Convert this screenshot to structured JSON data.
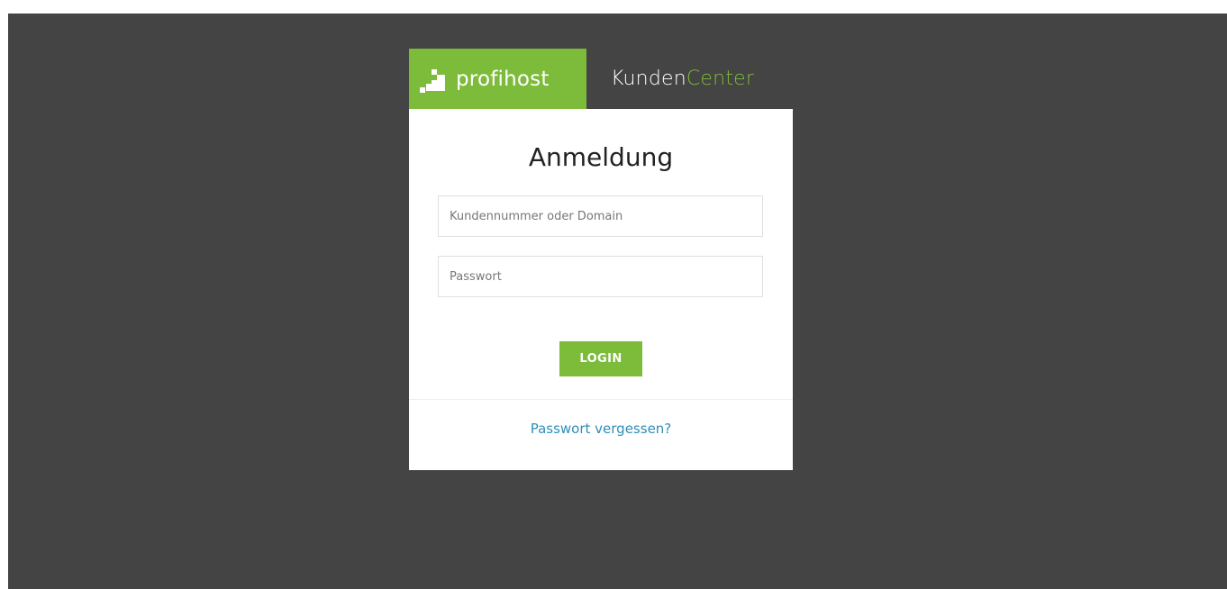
{
  "brand": {
    "name": "profihost",
    "logo_icon": "profihost-logo-icon",
    "color": "#7dbb3a"
  },
  "app_title": {
    "part1": "Kunden",
    "part2": "Center"
  },
  "login": {
    "title": "Anmeldung",
    "username_placeholder": "Kundennummer oder Domain",
    "username_value": "",
    "password_placeholder": "Passwort",
    "password_value": "",
    "submit_label": "LOGIN",
    "forgot_label": "Passwort vergessen?"
  },
  "colors": {
    "background": "#444444",
    "accent": "#7dbb3a",
    "link": "#2e8fb8"
  }
}
